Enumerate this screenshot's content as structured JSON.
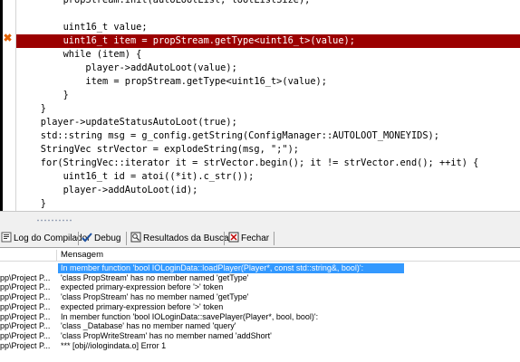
{
  "editor": {
    "lines": [
      {
        "text": "        propStream.init(autoLootList, lootListSize);",
        "highlight": false
      },
      {
        "text": "",
        "highlight": false
      },
      {
        "text": "        uint16_t value;",
        "highlight": false
      },
      {
        "text": "        uint16_t item = propStream.getType<uint16_t>(value);",
        "highlight": true
      },
      {
        "text": "        while (item) {",
        "highlight": false
      },
      {
        "text": "            player->addAutoLoot(value);",
        "highlight": false
      },
      {
        "text": "            item = propStream.getType<uint16_t>(value);",
        "highlight": false
      },
      {
        "text": "        }",
        "highlight": false
      },
      {
        "text": "    }",
        "highlight": false
      },
      {
        "text": "    player->updateStatusAutoLoot(true);",
        "highlight": false
      },
      {
        "text": "    std::string msg = g_config.getString(ConfigManager::AUTOLOOT_MONEYIDS);",
        "highlight": false
      },
      {
        "text": "    StringVec strVector = explodeString(msg, \";\");",
        "highlight": false
      },
      {
        "text": "    for(StringVec::iterator it = strVector.begin(); it != strVector.end(); ++it) {",
        "highlight": false
      },
      {
        "text": "        uint16_t id = atoi((*it).c_str());",
        "highlight": false
      },
      {
        "text": "        player->addAutoLoot(id);",
        "highlight": false
      },
      {
        "text": "    }",
        "highlight": false
      },
      {
        "text": "",
        "highlight": false
      },
      {
        "text": "    //.........",
        "highlight": false
      }
    ]
  },
  "tabs": [
    {
      "label": "Log do Compilador",
      "icon": "compiler-log-icon"
    },
    {
      "label": "Debug",
      "icon": "debug-check-icon"
    },
    {
      "label": "Resultados da Busca",
      "icon": "search-results-icon"
    },
    {
      "label": "Fechar",
      "icon": "close-panel-icon"
    }
  ],
  "messages": {
    "header": {
      "unit": "",
      "message": "Mensagem"
    },
    "rows": [
      {
        "unit": "",
        "message": "In member function 'bool IOLoginData::loadPlayer(Player*, const std::string&, bool)':",
        "selected": true
      },
      {
        "unit": "pp\\Project P...",
        "message": "'class PropStream' has no member named 'getType'",
        "selected": false
      },
      {
        "unit": "pp\\Project P...",
        "message": "expected primary-expression before '>' token",
        "selected": false
      },
      {
        "unit": "pp\\Project P...",
        "message": "'class PropStream' has no member named 'getType'",
        "selected": false
      },
      {
        "unit": "pp\\Project P...",
        "message": "expected primary-expression before '>' token",
        "selected": false
      },
      {
        "unit": "pp\\Project P...",
        "message": "In member function 'bool IOLoginData::savePlayer(Player*, bool, bool)':",
        "selected": false
      },
      {
        "unit": "pp\\Project P...",
        "message": "'class _Database' has no member named 'query'",
        "selected": false
      },
      {
        "unit": "pp\\Project P...",
        "message": "'class PropWriteStream' has no member named 'addShort'",
        "selected": false
      },
      {
        "unit": "pp\\Project P...",
        "message": "*** [obj//iologindata.o] Error 1",
        "selected": false
      }
    ]
  },
  "colors": {
    "highlight_line": "#9b0000",
    "selection": "#3399ff"
  }
}
